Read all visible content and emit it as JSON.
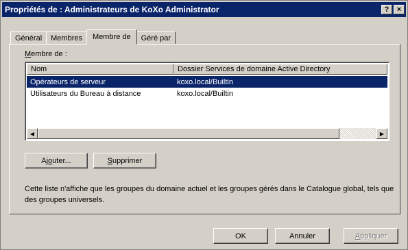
{
  "window": {
    "title": "Propriétés de : Administrateurs de KoXo Administrator",
    "help_glyph": "?",
    "close_glyph": "×"
  },
  "tabs": [
    {
      "label": "Général",
      "active": false
    },
    {
      "label": "Membres",
      "active": false
    },
    {
      "label": "Membre de",
      "active": true
    },
    {
      "label": "Géré par",
      "active": false
    }
  ],
  "member_of": {
    "label_accel": "M",
    "label_rest": "embre de :",
    "columns": [
      "Nom",
      "Dossier Services de domaine Active Directory"
    ],
    "rows": [
      {
        "name": "Opérateurs de serveur",
        "folder": "koxo.local/Builtin",
        "selected": true
      },
      {
        "name": "Utilisateurs du Bureau à distance",
        "folder": "koxo.local/Builtin",
        "selected": false
      }
    ]
  },
  "buttons": {
    "add_pre": "Aj",
    "add_accel": "o",
    "add_post": "uter...",
    "remove_accel": "S",
    "remove_post": "upprimer"
  },
  "info_text": "Cette liste n'affiche que les groupes du domaine actuel et les groupes gérés dans le Catalogue global, tels que des groupes universels.",
  "dialog_buttons": {
    "ok": "OK",
    "cancel": "Annuler",
    "apply_accel": "A",
    "apply_rest": "ppliquer"
  }
}
